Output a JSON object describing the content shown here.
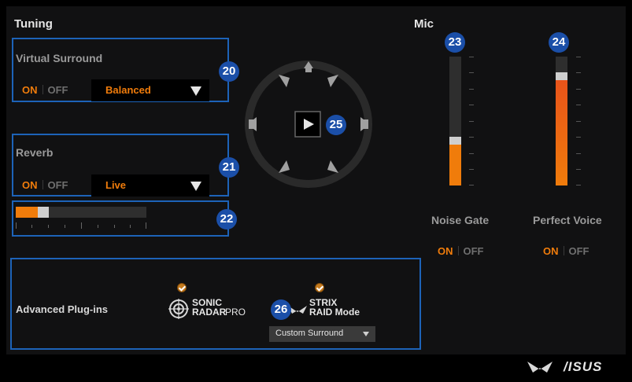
{
  "tuning": {
    "title": "Tuning",
    "virtual_surround": {
      "label": "Virtual Surround",
      "on_label": "ON",
      "off_label": "OFF",
      "state": "ON",
      "selected": "Balanced",
      "badge": "20"
    },
    "reverb": {
      "label": "Reverb",
      "on_label": "ON",
      "off_label": "OFF",
      "state": "ON",
      "selected": "Live",
      "badge": "21"
    },
    "reverb_level": {
      "fill": 0.17,
      "badge": "22"
    },
    "surround_play_badge": "25"
  },
  "mic": {
    "title": "Mic",
    "meter_1": {
      "badge": "23",
      "level": 0.32,
      "marker": 0.32
    },
    "meter_2": {
      "badge": "24",
      "level": 0.82,
      "marker": 0.82
    },
    "noise_gate": {
      "label": "Noise Gate",
      "on_label": "ON",
      "off_label": "OFF",
      "state": "ON"
    },
    "perfect_voice": {
      "label": "Perfect Voice",
      "on_label": "ON",
      "off_label": "OFF",
      "state": "ON"
    }
  },
  "advanced": {
    "label": "Advanced Plug-ins",
    "badge": "26",
    "sonic_radar": {
      "line1": "SONIC",
      "line2": "RADAR",
      "suffix": "PRO",
      "checked": true
    },
    "strix_raid": {
      "line1": "STRIX",
      "line2": "RAID Mode",
      "checked": true,
      "dropdown": "Custom Surround"
    }
  },
  "footer": {
    "brand": "/ISUS"
  },
  "colors": {
    "accent": "#f07c0b",
    "box_border": "#1d63b8",
    "badge": "#1b4fa8"
  }
}
